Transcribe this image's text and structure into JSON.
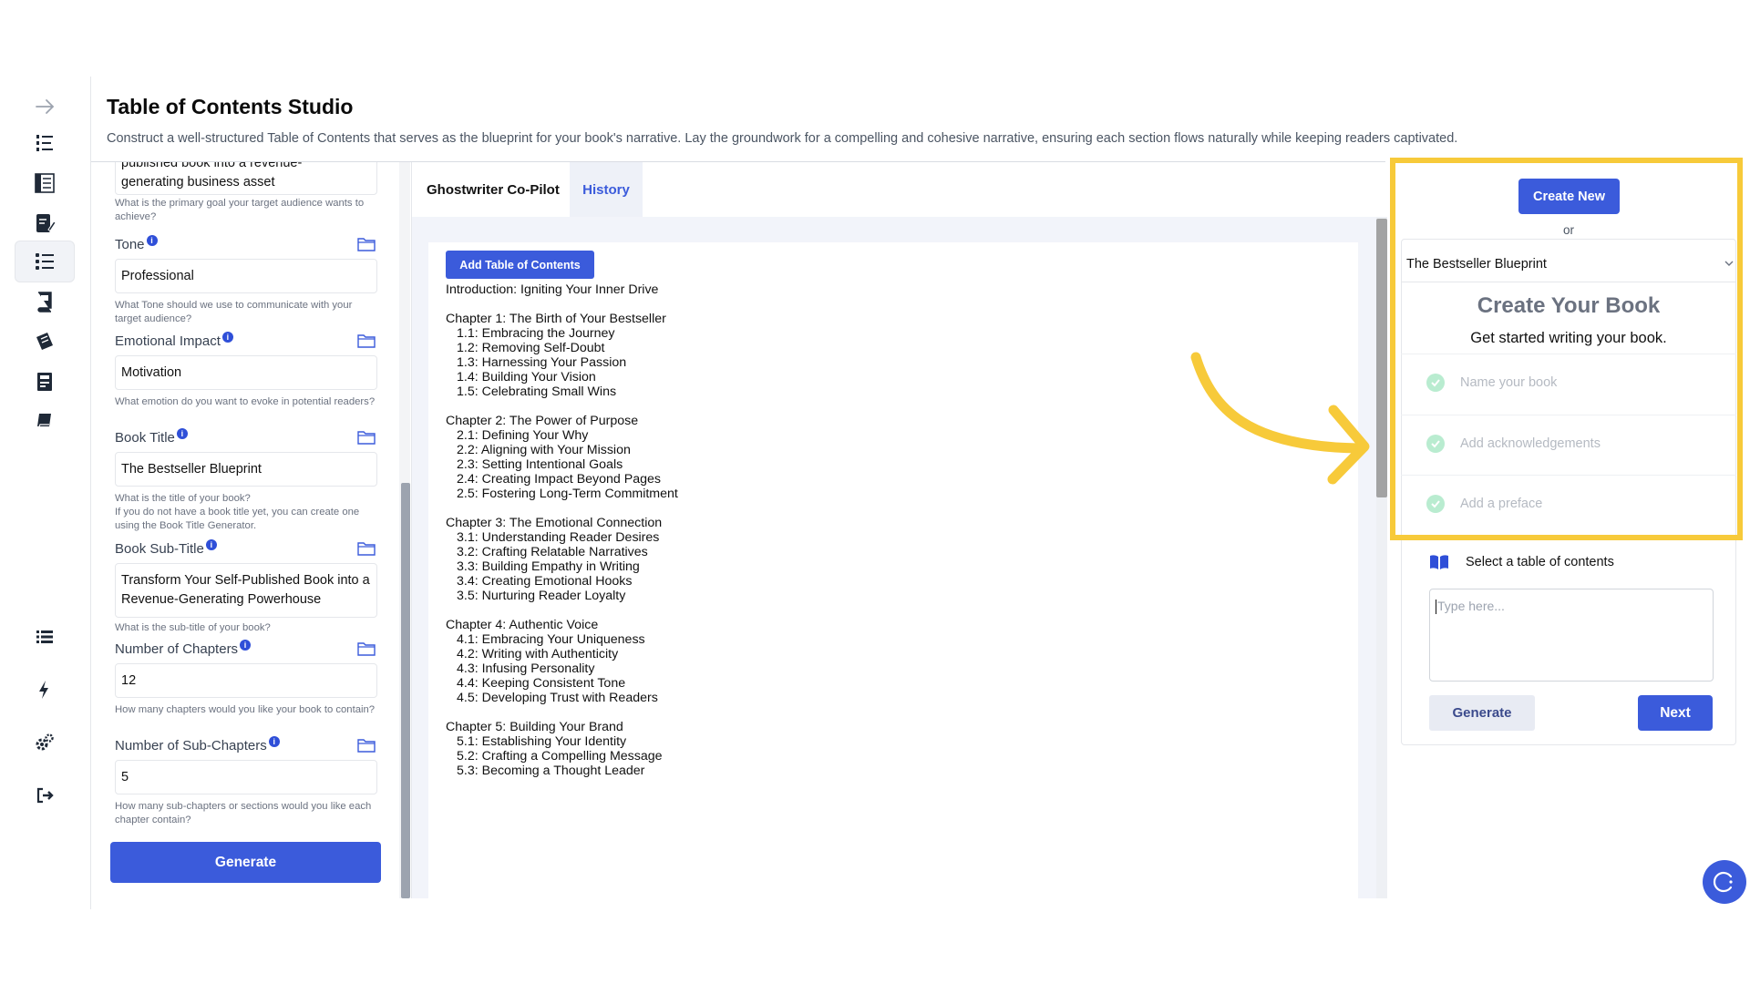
{
  "header": {
    "title": "Table of Contents Studio",
    "subtitle": "Construct a well-structured Table of Contents that serves as the blueprint for your book's narrative. Lay the groundwork for a compelling and cohesive narrative, ensuring each section flows naturally while keeping readers captivated."
  },
  "rail": {
    "icons": [
      "arrow-right-icon",
      "numbered-list-icon",
      "outline-icon",
      "edit-document-icon",
      "toc-icon",
      "book-cover-icon",
      "manuscript-icon",
      "publish-icon",
      "book-icon",
      "list-icon",
      "lightning-icon",
      "settings-icon",
      "logout-icon"
    ],
    "active": "toc-icon"
  },
  "form": {
    "top_field": {
      "value_line1": "published book into a revenue-",
      "value_line2": "generating business asset",
      "help": "What is the primary goal your target audience wants to achieve?"
    },
    "tone": {
      "label": "Tone",
      "value": "Professional",
      "help": "What Tone should we use to communicate with your target audience?"
    },
    "emotional_impact": {
      "label": "Emotional Impact",
      "value": "Motivation",
      "help": "What emotion do you want to evoke in potential readers?"
    },
    "book_title": {
      "label": "Book Title",
      "value": "The Bestseller Blueprint",
      "help_line1": "What is the title of your book?",
      "help_line2": "If you do not have a book title yet, you can create one using the Book Title Generator."
    },
    "book_subtitle": {
      "label": "Book Sub-Title",
      "value": "Transform Your Self-Published Book into a Revenue-Generating Powerhouse",
      "help": "What is the sub-title of your book?"
    },
    "num_chapters": {
      "label": "Number of Chapters",
      "value": "12",
      "help": "How many chapters would you like your book to contain?"
    },
    "num_subchapters": {
      "label": "Number of Sub-Chapters",
      "value": "5",
      "help": "How many sub-chapters or sections would you like each chapter contain?"
    },
    "generate_label": "Generate",
    "info_glyph": "i"
  },
  "center": {
    "tabs": {
      "ghostwriter": "Ghostwriter Co-Pilot",
      "history": "History"
    },
    "add_toc_label": "Add Table of Contents",
    "toc": [
      {
        "text": "Introduction: Igniting Your Inner Drive",
        "level": 0
      },
      {
        "text": "Chapter 1: The Birth of Your Bestseller",
        "level": 0
      },
      {
        "text": "1.1: Embracing the Journey",
        "level": 1
      },
      {
        "text": "1.2: Removing Self-Doubt",
        "level": 1
      },
      {
        "text": "1.3: Harnessing Your Passion",
        "level": 1
      },
      {
        "text": "1.4: Building Your Vision",
        "level": 1
      },
      {
        "text": "1.5: Celebrating Small Wins",
        "level": 1
      },
      {
        "text": "Chapter 2: The Power of Purpose",
        "level": 0
      },
      {
        "text": "2.1: Defining Your Why",
        "level": 1
      },
      {
        "text": "2.2: Aligning with Your Mission",
        "level": 1
      },
      {
        "text": "2.3: Setting Intentional Goals",
        "level": 1
      },
      {
        "text": "2.4: Creating Impact Beyond Pages",
        "level": 1
      },
      {
        "text": "2.5: Fostering Long-Term Commitment",
        "level": 1
      },
      {
        "text": "Chapter 3: The Emotional Connection",
        "level": 0
      },
      {
        "text": "3.1: Understanding Reader Desires",
        "level": 1
      },
      {
        "text": "3.2: Crafting Relatable Narratives",
        "level": 1
      },
      {
        "text": "3.3: Building Empathy in Writing",
        "level": 1
      },
      {
        "text": "3.4: Creating Emotional Hooks",
        "level": 1
      },
      {
        "text": "3.5: Nurturing Reader Loyalty",
        "level": 1
      },
      {
        "text": "Chapter 4: Authentic Voice",
        "level": 0
      },
      {
        "text": "4.1: Embracing Your Uniqueness",
        "level": 1
      },
      {
        "text": "4.2: Writing with Authenticity",
        "level": 1
      },
      {
        "text": "4.3: Infusing Personality",
        "level": 1
      },
      {
        "text": "4.4: Keeping Consistent Tone",
        "level": 1
      },
      {
        "text": "4.5: Developing Trust with Readers",
        "level": 1
      },
      {
        "text": "Chapter 5: Building Your Brand",
        "level": 0
      },
      {
        "text": "5.1: Establishing Your Identity",
        "level": 1
      },
      {
        "text": "5.2: Crafting a Compelling Message",
        "level": 1
      },
      {
        "text": "5.3: Becoming a Thought Leader",
        "level": 1
      }
    ]
  },
  "right": {
    "create_new_label": "Create New",
    "or_label": "or",
    "selected_book": "The Bestseller Blueprint",
    "heading": "Create Your Book",
    "subheading": "Get started writing your book.",
    "steps": [
      "Name your book",
      "Add acknowledgements",
      "Add a preface"
    ],
    "select_toc_label": "Select a table of contents",
    "type_placeholder": "Type here...",
    "generate_label": "Generate",
    "next_label": "Next"
  },
  "colors": {
    "accent": "#3b5bdb",
    "highlight": "#f7ca3a",
    "check": "#b9ecd0"
  }
}
